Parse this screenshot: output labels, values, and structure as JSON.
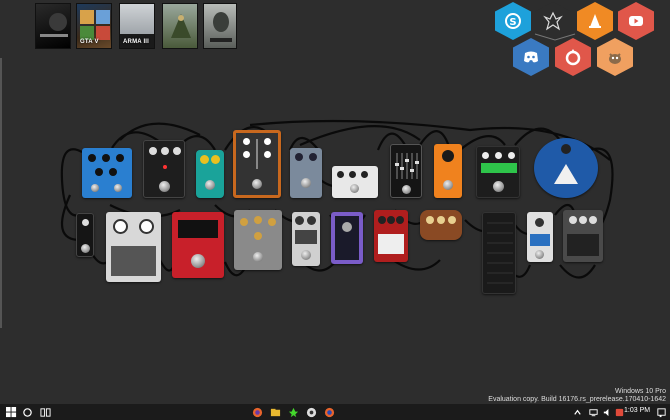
{
  "games": [
    {
      "name": "game-tile-1",
      "caption": ""
    },
    {
      "name": "game-tile-gta",
      "caption": "GTA V"
    },
    {
      "name": "game-tile-arma",
      "caption": "ARMA III"
    },
    {
      "name": "game-tile-4",
      "caption": ""
    },
    {
      "name": "game-tile-5",
      "caption": ""
    }
  ],
  "launcher": {
    "icons": [
      "skype-icon",
      "skyrim-icon",
      "vlc-icon",
      "youtube-icon",
      "discord-icon",
      "origin-icon",
      "gimp-icon"
    ]
  },
  "watermark": {
    "line1": "Windows 10 Pro",
    "line2": "Evaluation copy. Build 16176.rs_prerelease.170410-1642"
  },
  "taskbar": {
    "time": "1:03 PM",
    "apps": [
      "file-explorer-icon",
      "firefox-icon",
      "razer-icon",
      "chrome-icon",
      "firefox-alt-icon"
    ]
  },
  "colors": {
    "background": "#2d2d2d",
    "taskbar": "#1b1b1b",
    "skype": "#1ea1db",
    "vlc": "#f08a24",
    "youtube": "#e0574a",
    "discord": "#3a7ac2",
    "origin": "#e0574a",
    "gimp": "#f0a060"
  }
}
